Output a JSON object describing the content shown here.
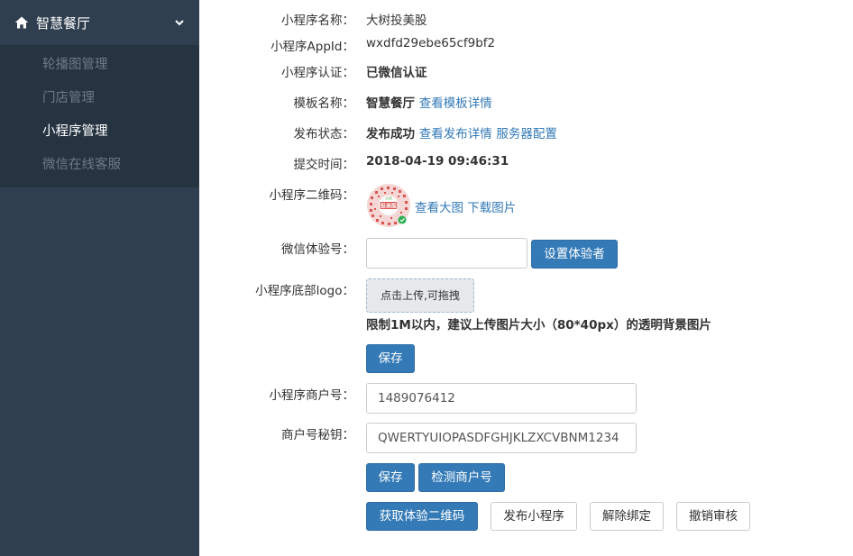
{
  "sidebar": {
    "title": "智慧餐厅",
    "items": [
      {
        "label": "轮播图管理"
      },
      {
        "label": "门店管理"
      },
      {
        "label": "小程序管理"
      },
      {
        "label": "微信在线客服"
      }
    ]
  },
  "form": {
    "name_label": "小程序名称：",
    "name_value": "大树投美股",
    "appid_label": "小程序AppId：",
    "appid_value": "wxdfd29ebe65cf9bf2",
    "auth_label": "小程序认证：",
    "auth_value": "已微信认证",
    "template_label": "模板名称：",
    "template_value": "智慧餐厅",
    "template_link": "查看模板详情",
    "publish_label": "发布状态：",
    "publish_value": "发布成功",
    "publish_link": "查看发布详情",
    "server_link": "服务器配置",
    "submit_time_label": "提交时间：",
    "submit_time_value": "2018-04-19 09:46:31",
    "qrcode_label": "小程序二维码：",
    "qrcode_text": "投美股",
    "qrcode_text_small": "大树",
    "qrcode_view_link": "查看大图",
    "qrcode_download_link": "下载图片",
    "tester_label": "微信体验号：",
    "tester_value": "",
    "set_tester_button": "设置体验者",
    "logo_label": "小程序底部logo：",
    "upload_label": "点击上传,可拖拽",
    "logo_hint": "限制1M以内，建议上传图片大小（80*40px）的透明背景图片",
    "save_logo_button": "保存",
    "merchant_label": "小程序商户号：",
    "merchant_value": "1489076412",
    "secret_label": "商户号秘钥：",
    "secret_value": "QWERTYUIOPASDFGHJKLZXCVBNM1234",
    "save_merchant_button": "保存",
    "check_merchant_button": "检测商户号"
  },
  "actions": {
    "get_qrcode": "获取体验二维码",
    "publish": "发布小程序",
    "unbind": "解除绑定",
    "revoke": "撤销审核"
  },
  "colors": {
    "sidebar_bg": "#2f3f4f",
    "sidebar_sub_bg": "#263442",
    "primary": "#337ab7",
    "link": "#337ab7"
  },
  "icons": {
    "home": "home-icon",
    "chevron": "chevron-down-icon",
    "qrcode": "qrcode-icon"
  }
}
